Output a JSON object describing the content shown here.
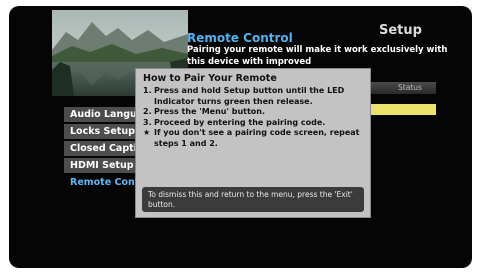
{
  "header": {
    "title": "Remote Control",
    "section": "Setup",
    "description": "Pairing your remote will make it work exclusively with this device with improved"
  },
  "status": {
    "label": "Status"
  },
  "menu": {
    "items": [
      {
        "label": "Audio Language",
        "active": false
      },
      {
        "label": "Locks Setup",
        "active": false
      },
      {
        "label": "Closed Captioning",
        "active": false
      },
      {
        "label": "HDMI Setup",
        "active": false
      },
      {
        "label": "Remote Control",
        "active": true
      }
    ]
  },
  "popup": {
    "title": "How to Pair Your Remote",
    "steps": [
      {
        "marker": "1.",
        "text": "Press and hold Setup button until the LED Indicator turns green then release."
      },
      {
        "marker": "2.",
        "text": "Press the 'Menu' button."
      },
      {
        "marker": "3.",
        "text": "Proceed by entering the pairing code."
      },
      {
        "marker": "★",
        "text": "If you don't see a pairing code screen, repeat steps 1 and 2."
      }
    ],
    "dismiss_note": "To dismiss this and return to the menu, press the 'Exit' button."
  },
  "colors": {
    "accent": "#4fb3f2",
    "highlight_bar": "#ece16b",
    "popup_bg": "#c3c3c3",
    "screen_bg": "#050505"
  },
  "icons": {
    "thumbnail": "mountain-lake-landscape-image"
  }
}
